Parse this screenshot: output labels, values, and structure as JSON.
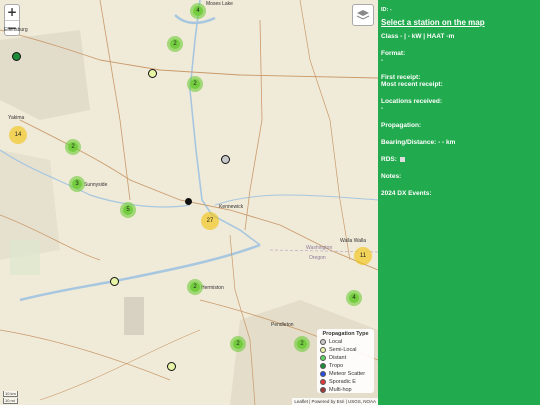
{
  "map": {
    "zoom_in": "+",
    "zoom_out": "−",
    "places": {
      "moses_lake": "Moses Lake",
      "ellensburg": "Ellensburg",
      "yakima": "Yakima",
      "sunnyside": "Sunnyside",
      "kennewick": "Kennewick",
      "walla_walla": "Walla Walla",
      "washington": "Washington",
      "oregon": "Oregon",
      "hermiston": "Hermiston",
      "pendleton": "Pendleton"
    },
    "clusters": [
      {
        "count": "4"
      },
      {
        "count": "2"
      },
      {
        "count": "2"
      },
      {
        "count": "14"
      },
      {
        "count": "2"
      },
      {
        "count": "3"
      },
      {
        "count": "5"
      },
      {
        "count": "27"
      },
      {
        "count": "11"
      },
      {
        "count": "4"
      },
      {
        "count": "2"
      },
      {
        "count": "2"
      },
      {
        "count": "2"
      }
    ],
    "scale": {
      "label1": "10 km",
      "label2": "10 mi"
    },
    "attribution": "Leaflet | Powered by Esri | USGS, NOAA"
  },
  "legend": {
    "title": "Propagation Type",
    "items": [
      {
        "label": "Local",
        "color": "#c8c8c8"
      },
      {
        "label": "Semi-Local",
        "color": "#e9f5a6"
      },
      {
        "label": "Distant",
        "color": "#5fd35f"
      },
      {
        "label": "Tropo",
        "color": "#1e8c3a"
      },
      {
        "label": "Meteor Scatter",
        "color": "#2a4de0"
      },
      {
        "label": "Sporadic E",
        "color": "#e03a3a"
      },
      {
        "label": "Multi-hop",
        "color": "#9e3a3a"
      }
    ]
  },
  "panel": {
    "id": "ID: -",
    "title": "Select a station on the map",
    "class_line": "Class - | - kW | HAAT -m",
    "format_label": "Format:",
    "format_value": "-",
    "first_receipt": "First receipt:",
    "recent_receipt": "Most recent receipt:",
    "locations_label": "Locations received:",
    "locations_value": "-",
    "propagation": "Propagation:",
    "bearing": "Bearing/Distance: - - km",
    "rds": "RDS:",
    "notes": "Notes:",
    "dx_events": "2024 DX Events:"
  }
}
